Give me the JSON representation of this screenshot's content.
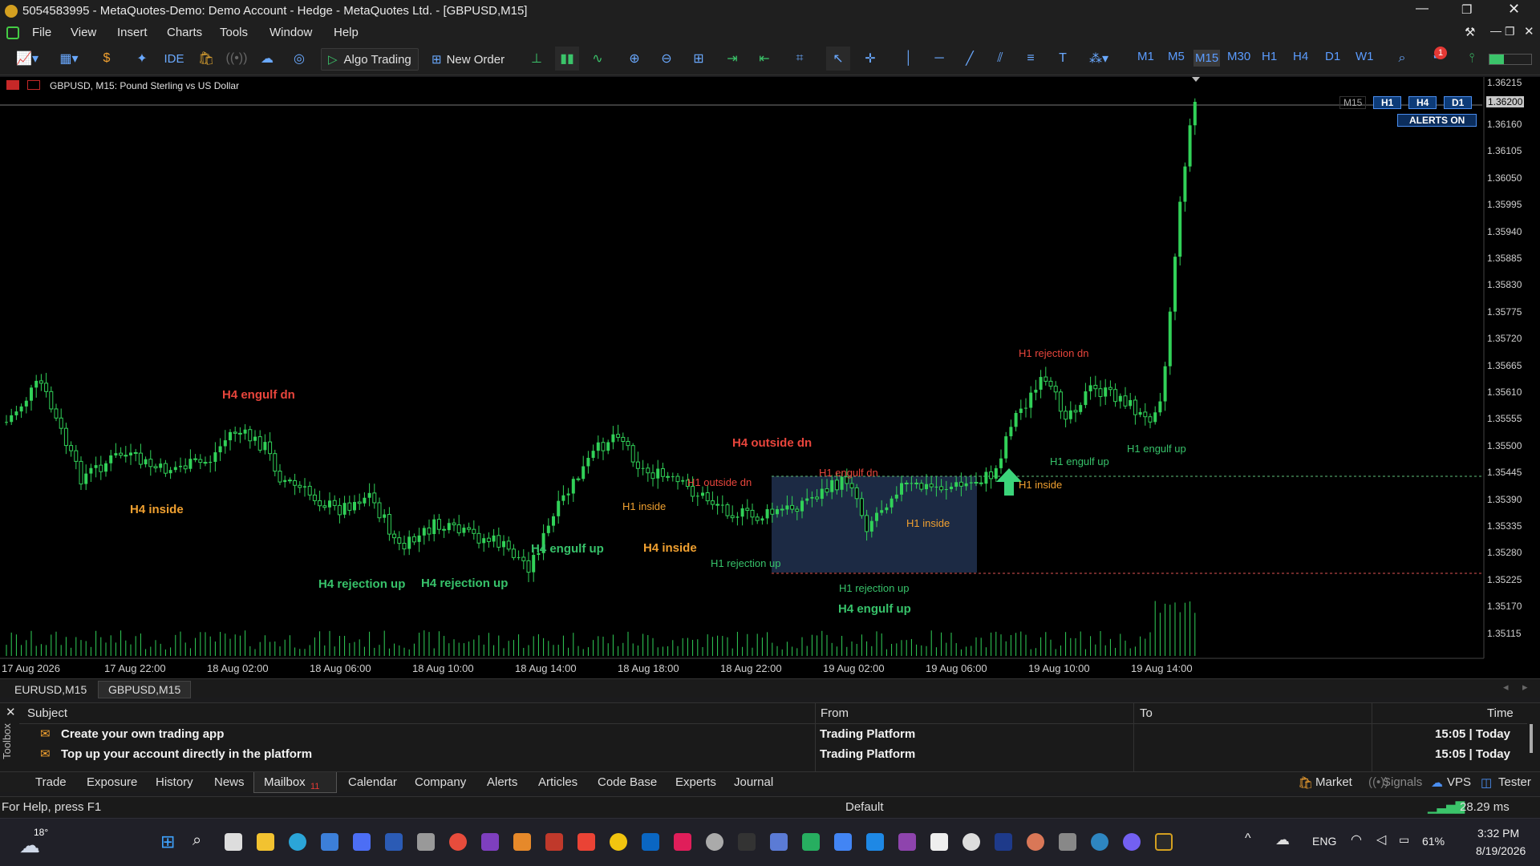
{
  "window": {
    "title": "5054583995 - MetaQuotes-Demo: Demo Account - Hedge - MetaQuotes Ltd. - [GBPUSD,M15]"
  },
  "menu": [
    "File",
    "View",
    "Insert",
    "Charts",
    "Tools",
    "Window",
    "Help"
  ],
  "toolbar": {
    "ide": "IDE",
    "algo_trading": "Algo Trading",
    "new_order": "New Order"
  },
  "timeframes": [
    "M1",
    "M5",
    "M15",
    "M30",
    "H1",
    "H4",
    "D1",
    "W1"
  ],
  "active_timeframe": "M15",
  "notification_count": "1",
  "chart": {
    "caption": "GBPUSD, M15:  Pound Sterling vs US Dollar",
    "tf_buttons": [
      "M15",
      "H1",
      "H4",
      "D1"
    ],
    "alerts_label": "ALERTS ON",
    "current_price": "1.36200",
    "top_price": "1.36215",
    "price_scale": [
      "1.36160",
      "1.36105",
      "1.36050",
      "1.35995",
      "1.35940",
      "1.35885",
      "1.35830",
      "1.35775",
      "1.35720",
      "1.35665",
      "1.35610",
      "1.35555",
      "1.35500",
      "1.35445",
      "1.35390",
      "1.35335",
      "1.35280",
      "1.35225",
      "1.35170",
      "1.35115"
    ],
    "date_axis": [
      "17 Aug 2026",
      "17 Aug 22:00",
      "18 Aug 02:00",
      "18 Aug 06:00",
      "18 Aug 10:00",
      "18 Aug 14:00",
      "18 Aug 18:00",
      "18 Aug 22:00",
      "19 Aug 02:00",
      "19 Aug 06:00",
      "19 Aug 10:00",
      "19 Aug 14:00"
    ],
    "annotations": {
      "h4_engulf_dn": "H4 engulf dn",
      "h4_inside_1": "H4 inside",
      "h4_rejection_up_1": "H4 rejection up",
      "h4_rejection_up_2": "H4 rejection up",
      "h4_engulf_up_1": "H4 engulf up",
      "h1_inside_1": "H1 inside",
      "h4_inside_2": "H4 inside",
      "h1_outside_dn": "H1 outside dn",
      "h4_outside_dn": "H4 outside dn",
      "h1_engulf_dn": "H1 engulf dn",
      "h1_rejection_up_1": "H1 rejection up",
      "h1_inside_2": "H1 inside",
      "h1_rejection_up_2": "H1 rejection up",
      "h4_engulf_up_2": "H4 engulf up",
      "h1_inside_3": "H1 inside",
      "h1_rejection_dn": "H1 rejection dn",
      "h1_engulf_up_1": "H1 engulf up",
      "h1_engulf_up_2": "H1 engulf up"
    }
  },
  "chart_tabs": [
    "EURUSD,M15",
    "GBPUSD,M15"
  ],
  "mailbox": {
    "headers": {
      "subject": "Subject",
      "from": "From",
      "to": "To",
      "time": "Time"
    },
    "rows": [
      {
        "subject": "Create your own trading app",
        "from": "Trading Platform",
        "to": "",
        "time": "15:05 | Today"
      },
      {
        "subject": "Top up your account directly in the platform",
        "from": "Trading Platform",
        "to": "",
        "time": "15:05 | Today"
      }
    ]
  },
  "toolbox_label": "Toolbox",
  "bottom_tabs": [
    "Trade",
    "Exposure",
    "History",
    "News",
    "Mailbox",
    "Calendar",
    "Company",
    "Alerts",
    "Articles",
    "Code Base",
    "Experts",
    "Journal"
  ],
  "mailbox_count": "11",
  "bottom_right": {
    "market": "Market",
    "signals": "Signals",
    "vps": "VPS",
    "tester": "Tester"
  },
  "status": {
    "help": "For Help, press F1",
    "profile": "Default",
    "ping": "28.29 ms"
  },
  "taskbar": {
    "temperature": "18°",
    "lang": "ENG",
    "battery": "61%",
    "time": "3:32 PM",
    "date": "8/19/2026"
  },
  "colors": {
    "bull": "#31d158",
    "background": "#000000",
    "accent": "#4a8ef0",
    "box": "#1c2a44"
  }
}
